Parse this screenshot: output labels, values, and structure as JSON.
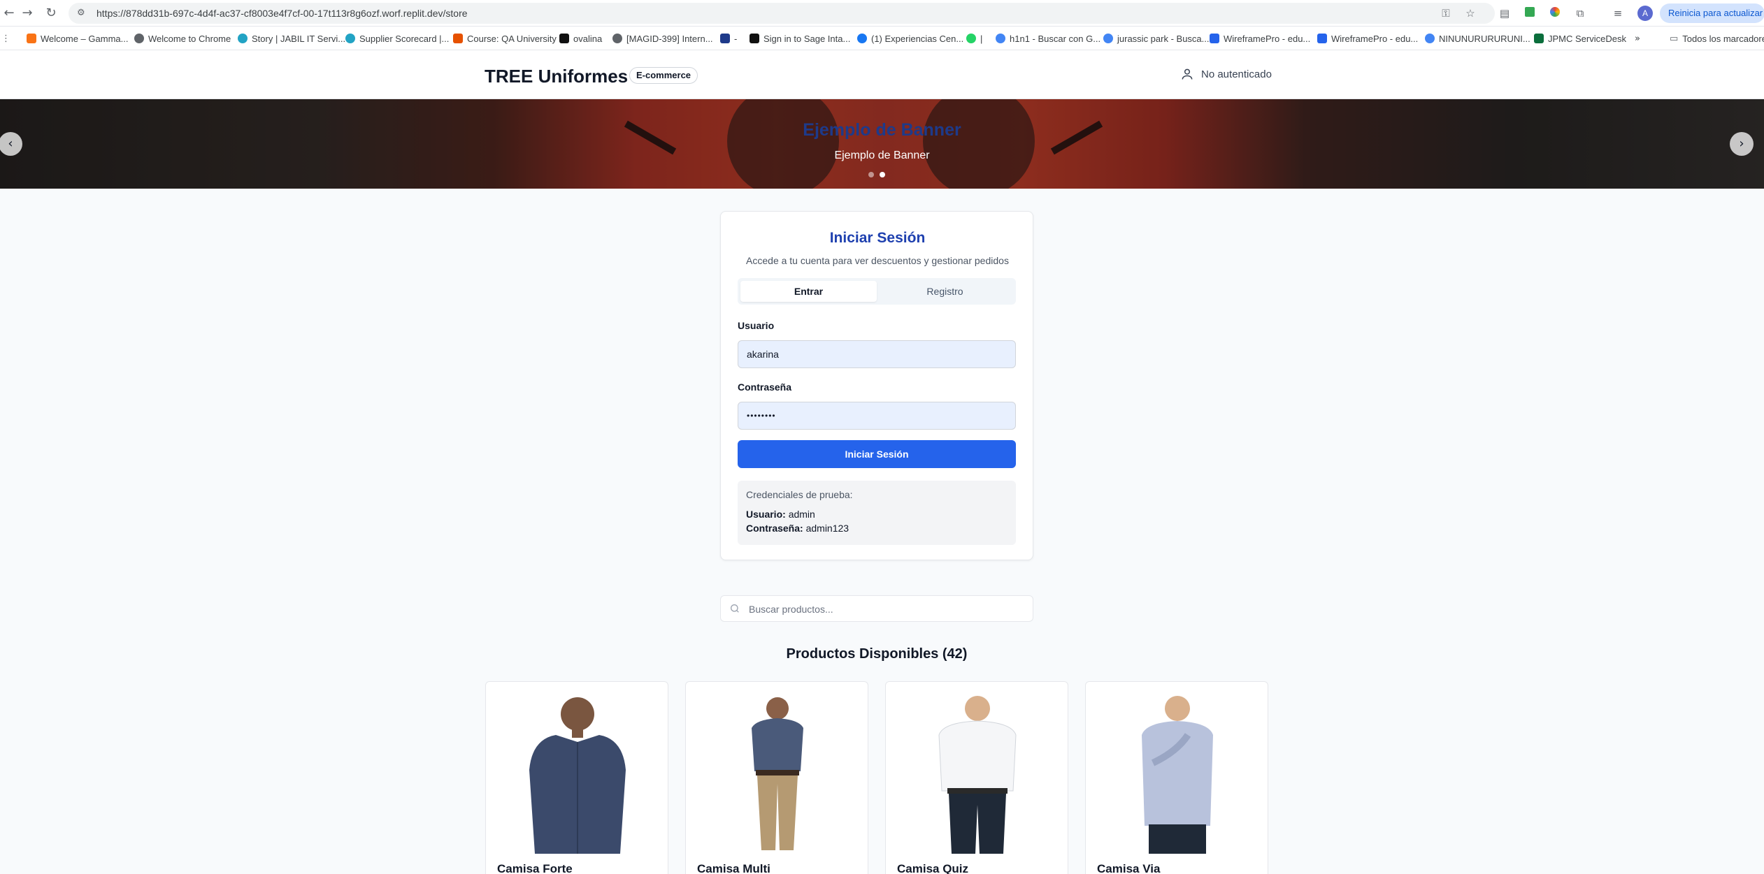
{
  "browser": {
    "url": "https://878dd31b-697c-4d4f-ac37-cf8003e4f7cf-00-17t113r8g6ozf.worf.replit.dev/store",
    "update_label": "Reinicia para actualizar",
    "profile_initial": "A",
    "bookmarks": [
      {
        "label": "Welcome – Gamma...",
        "icon": "gamma-favicon",
        "color": "#f97316"
      },
      {
        "label": "Welcome to Chrome",
        "icon": "chrome-favicon",
        "color": "#5f6368"
      },
      {
        "label": "Story | JABIL IT Servi...",
        "icon": "jabil-favicon",
        "color": "#22a3c4"
      },
      {
        "label": "Supplier Scorecard |...",
        "icon": "jabil-favicon",
        "color": "#22a3c4"
      },
      {
        "label": "Course: QA University",
        "icon": "qa-favicon",
        "color": "#e65100"
      },
      {
        "label": "ovalina",
        "icon": "ovalina-favicon",
        "color": "#111111"
      },
      {
        "label": "[MAGID-399] Intern...",
        "icon": "globe-favicon",
        "color": "#5f6368"
      },
      {
        "label": "-",
        "icon": "app-favicon",
        "color": "#1e3a8a"
      },
      {
        "label": "Sign in to Sage Inta...",
        "icon": "sage-favicon",
        "color": "#111111"
      },
      {
        "label": "(1) Experiencias Cen...",
        "icon": "facebook-favicon",
        "color": "#1877f2"
      },
      {
        "label": "|",
        "icon": "whatsapp-favicon",
        "color": "#25d366"
      },
      {
        "label": "h1n1 - Buscar con G...",
        "icon": "google-favicon",
        "color": "#4285f4"
      },
      {
        "label": "jurassic park - Busca...",
        "icon": "google-favicon",
        "color": "#4285f4"
      },
      {
        "label": "WireframePro - edu...",
        "icon": "wireframepro-favicon",
        "color": "#2563eb"
      },
      {
        "label": "WireframePro - edu...",
        "icon": "wireframepro-favicon",
        "color": "#2563eb"
      },
      {
        "label": "NINUNURURURUNI...",
        "icon": "google-favicon",
        "color": "#4285f4"
      },
      {
        "label": "JPMC ServiceDesk",
        "icon": "servicedesk-favicon",
        "color": "#0b6e3c"
      }
    ],
    "all_bookmarks_label": "Todos los marcadores"
  },
  "header": {
    "brand": "TREE Uniformes",
    "badge": "E-commerce",
    "auth_status": "No autenticado"
  },
  "banner": {
    "title": "Ejemplo de Banner",
    "subtitle": "Ejemplo de Banner",
    "slide_count": 2,
    "active_slide": 2
  },
  "login": {
    "title": "Iniciar Sesión",
    "description": "Accede a tu cuenta para ver descuentos y gestionar pedidos",
    "tabs": [
      {
        "label": "Entrar",
        "active": true
      },
      {
        "label": "Registro",
        "active": false
      }
    ],
    "username_label": "Usuario",
    "username_value": "akarina",
    "password_label": "Contraseña",
    "password_value": "••••••••",
    "submit_label": "Iniciar Sesión",
    "creds_heading": "Credenciales de prueba:",
    "creds_user_label": "Usuario:",
    "creds_user_value": "admin",
    "creds_pass_label": "Contraseña:",
    "creds_pass_value": "admin123"
  },
  "search": {
    "placeholder": "Buscar productos..."
  },
  "products": {
    "heading": "Productos Disponibles (42)",
    "items": [
      {
        "name": "Camisa Forte",
        "shirt_color": "#3b4a6b",
        "pants_color": "none"
      },
      {
        "name": "Camisa Multi",
        "shirt_color": "#4a5a7a",
        "pants_color": "#b59a72"
      },
      {
        "name": "Camisa Quiz",
        "shirt_color": "#f5f6f8",
        "pants_color": "#1f2937"
      },
      {
        "name": "Camisa Via",
        "shirt_color": "#b8c2dc",
        "pants_color": "#1f2937"
      }
    ]
  },
  "colors": {
    "primary": "#2563eb",
    "title_blue": "#1e40af",
    "banner_title": "#1e3a8a"
  }
}
